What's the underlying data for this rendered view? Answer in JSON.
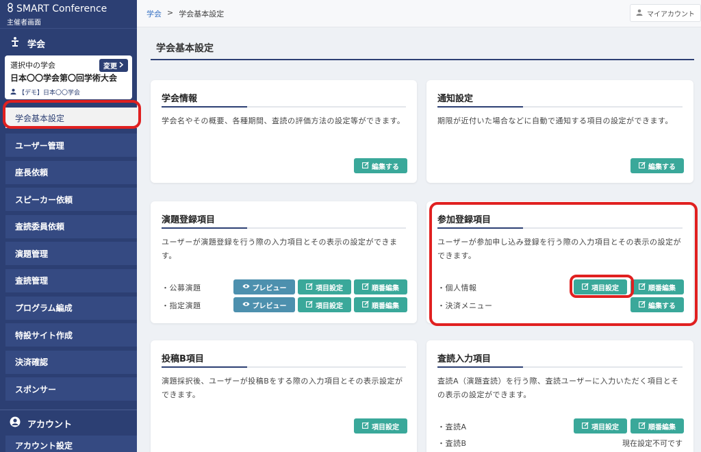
{
  "brand": {
    "title": "SMART Conference",
    "subtitle": "主催者画面"
  },
  "sidebar": {
    "section_society": "学会",
    "conference": {
      "label": "選択中の学会",
      "name": "日本〇〇学会第〇回学術大会",
      "org": "【デモ】日本〇〇学会",
      "change_label": "変更"
    },
    "items": [
      {
        "label": "学会基本設定"
      },
      {
        "label": "ユーザー管理"
      },
      {
        "label": "座長依頼"
      },
      {
        "label": "スピーカー依頼"
      },
      {
        "label": "査読委員依頼"
      },
      {
        "label": "演題管理"
      },
      {
        "label": "査読管理"
      },
      {
        "label": "プログラム編成"
      },
      {
        "label": "特設サイト作成"
      },
      {
        "label": "決済確認"
      },
      {
        "label": "スポンサー"
      }
    ],
    "section_account": "アカウント",
    "account_item": "アカウント設定"
  },
  "topbar": {
    "crumb_root": "学会",
    "crumb_sep": ">",
    "crumb_current": "学会基本設定",
    "account_label": "マイアカウント"
  },
  "page_title": "学会基本設定",
  "cards": {
    "society_info": {
      "title": "学会情報",
      "desc": "学会名やその概要、各種期間、査読の評価方法の設定等ができます。",
      "edit": "編集する"
    },
    "notification": {
      "title": "通知設定",
      "desc": "期限が近付いた場合などに自動で通知する項目の設定ができます。",
      "edit": "編集する"
    },
    "abstract_fields": {
      "title": "演題登録項目",
      "desc": "ユーザーが演題登録を行う際の入力項目とその表示の設定ができます。",
      "rows": [
        {
          "label": "・公募演題",
          "preview": "プレビュー",
          "fields": "項目設定",
          "order": "順番編集"
        },
        {
          "label": "・指定演題",
          "preview": "プレビュー",
          "fields": "項目設定",
          "order": "順番編集"
        }
      ]
    },
    "participant_fields": {
      "title": "参加登録項目",
      "desc": "ユーザーが参加申し込み登録を行う際の入力項目とその表示の設定ができます。",
      "rows": [
        {
          "label": "・個人情報",
          "fields": "項目設定",
          "order": "順番編集"
        },
        {
          "label": "・決済メニュー",
          "edit": "編集する"
        }
      ]
    },
    "submission_b": {
      "title": "投稿B項目",
      "desc": "演題採択後、ユーザーが投稿Bをする際の入力項目とその表示設定ができます。",
      "fields": "項目設定"
    },
    "review_input": {
      "title": "査読入力項目",
      "desc": "査読A（演題査読）を行う際、査読ユーザーに入力いただく項目とその表示の設定ができます。",
      "rows": [
        {
          "label": "・査読A",
          "fields": "項目設定",
          "order": "順番編集"
        },
        {
          "label": "・査読B",
          "status": "現在設定不可です"
        }
      ]
    }
  },
  "colors": {
    "sidebar": "#2c3f73",
    "button": "#3aa89a",
    "preview_button": "#4d90ae",
    "highlight": "#e02020"
  }
}
